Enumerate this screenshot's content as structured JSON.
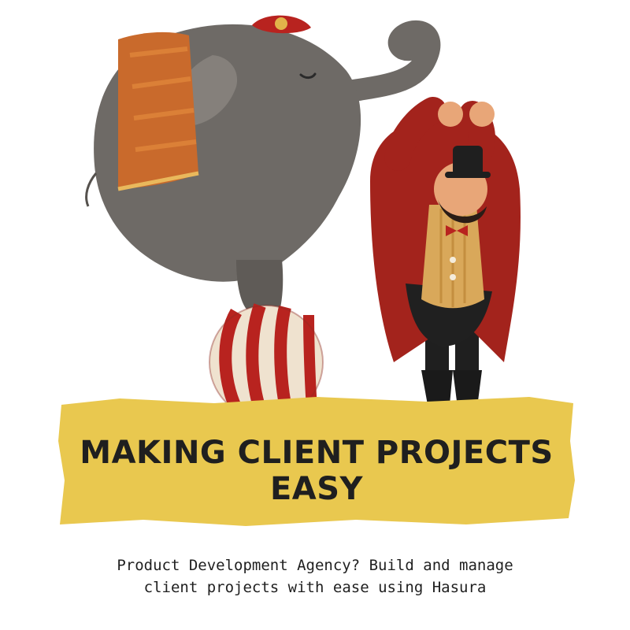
{
  "banner": {
    "headline_line1": "MAKING CLIENT PROJECTS",
    "headline_line2": "EASY",
    "color": "#e9c84f"
  },
  "tagline": {
    "line1": "Product Development Agency? Build and manage",
    "line2": "client projects with ease using Hasura"
  },
  "illustration": {
    "elephant_color": "#6e6a66",
    "blanket_color": "#c96a2c",
    "ball_red": "#b8231f",
    "ball_cream": "#efe2cf",
    "coat_color": "#a3231c",
    "vest_color": "#d9a85a"
  }
}
